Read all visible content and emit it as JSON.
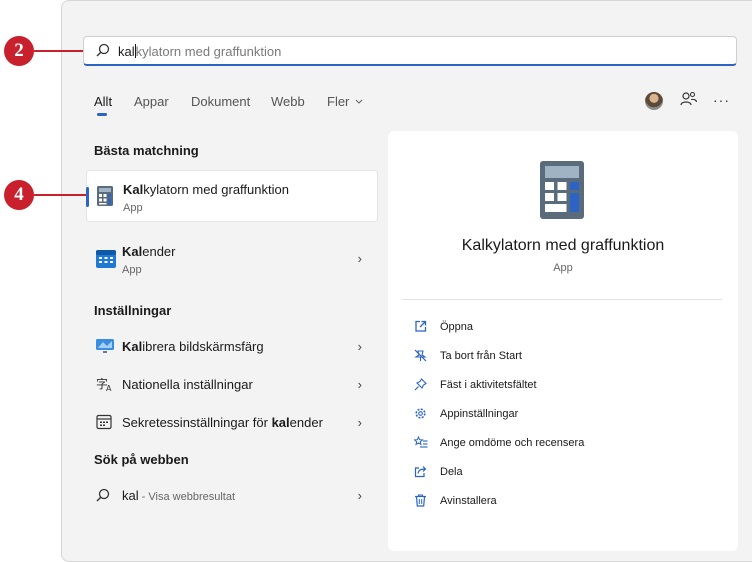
{
  "callouts": [
    "2",
    "4"
  ],
  "search": {
    "typed": "kal",
    "completion": "kylatorn med graffunktion"
  },
  "tabs": [
    "Allt",
    "Appar",
    "Dokument",
    "Webb",
    "Fler"
  ],
  "header_icons": [
    "avatar",
    "people-icon",
    "more-icon"
  ],
  "more_label": "···",
  "best_match": {
    "title": "Bästa matchning",
    "items": [
      {
        "title_bold": "Kal",
        "title_rest": "kylatorn med graffunktion",
        "subtitle": "App",
        "icon": "calculator-icon",
        "selected": true
      },
      {
        "title_bold": "Kal",
        "title_rest": "ender",
        "subtitle": "App",
        "icon": "calendar-icon",
        "chevron": "›"
      }
    ]
  },
  "settings": {
    "title": "Inställningar",
    "items": [
      {
        "pre": "",
        "bold": "Kal",
        "post": "ibrera bildskärmsfärg",
        "icon": "display-icon",
        "chevron": "›"
      },
      {
        "pre": "Nationella inställningar",
        "bold": "",
        "post": "",
        "icon": "language-icon",
        "chevron": "›"
      },
      {
        "pre": "Sekretessinställningar för ",
        "bold": "kal",
        "post": "ender",
        "icon": "calendar-small-icon",
        "chevron": "›"
      }
    ]
  },
  "web": {
    "title": "Sök på webben",
    "query": "kal",
    "hint": " - Visa webbresultat",
    "chevron": "›"
  },
  "preview": {
    "title": "Kalkylatorn med graffunktion",
    "subtitle": "App",
    "actions": [
      {
        "label": "Öppna",
        "icon": "open-icon"
      },
      {
        "label": "Ta bort från Start",
        "icon": "unpin-icon"
      },
      {
        "label": "Fäst i aktivitetsfältet",
        "icon": "pin-icon"
      },
      {
        "label": "Appinställningar",
        "icon": "gear-icon"
      },
      {
        "label": "Ange omdöme och recensera",
        "icon": "rate-icon"
      },
      {
        "label": "Dela",
        "icon": "share-icon"
      },
      {
        "label": "Avinstallera",
        "icon": "trash-icon"
      }
    ]
  },
  "colors": {
    "accent": "#2b64c4",
    "callout": "#c8202c"
  }
}
